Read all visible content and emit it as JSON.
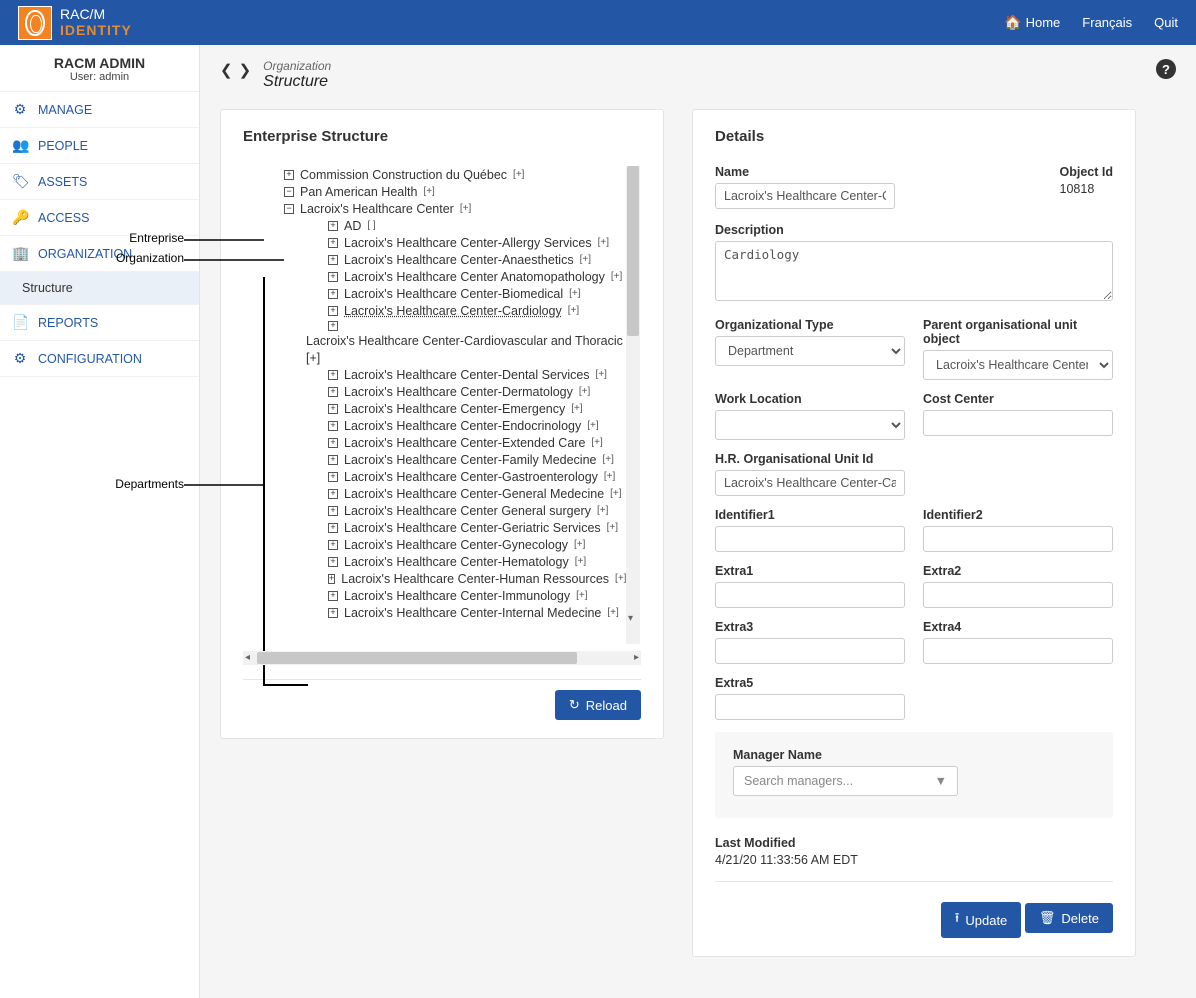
{
  "brand": {
    "line1": "RAC/M",
    "line2": "IDENTITY"
  },
  "topnav": {
    "home": "Home",
    "lang": "Français",
    "quit": "Quit"
  },
  "sidebar": {
    "title": "RACM ADMIN",
    "user_label": "User: admin",
    "items": [
      {
        "icon": "⚙",
        "label": "MANAGE"
      },
      {
        "icon": "👥",
        "label": "PEOPLE"
      },
      {
        "icon": "🏷",
        "label": "ASSETS"
      },
      {
        "icon": "🔑",
        "label": "ACCESS"
      },
      {
        "icon": "🏢",
        "label": "ORGANIZATION"
      },
      {
        "icon": "📄",
        "label": "REPORTS"
      },
      {
        "icon": "⚙",
        "label": "CONFIGURATION"
      }
    ],
    "sub_structure": "Structure"
  },
  "breadcrumb": {
    "parent": "Organization",
    "page": "Structure"
  },
  "tree": {
    "title": "Enterprise Structure",
    "reload": "Reload",
    "nodes": [
      {
        "lvl": 1,
        "exp": "+",
        "label": "Commission Construction du Québec",
        "il": "[+]"
      },
      {
        "lvl": 1,
        "exp": "−",
        "label": "Pan American Health",
        "il": "[+]"
      },
      {
        "lvl": 1,
        "exp": "−",
        "label": "Lacroix's Healthcare Center",
        "il": "[+]"
      },
      {
        "lvl": 2,
        "exp": "+",
        "label": "AD",
        "il": "[ ]"
      },
      {
        "lvl": 2,
        "exp": "+",
        "label": "Lacroix's Healthcare Center-Allergy Services",
        "il": "[+]"
      },
      {
        "lvl": 2,
        "exp": "+",
        "label": "Lacroix's Healthcare Center-Anaesthetics",
        "il": "[+]"
      },
      {
        "lvl": 2,
        "exp": "+",
        "label": "Lacroix's Healthcare Center Anatomopathology",
        "il": "[+]"
      },
      {
        "lvl": 2,
        "exp": "+",
        "label": "Lacroix's Healthcare Center-Biomedical",
        "il": "[+]"
      },
      {
        "lvl": 2,
        "exp": "+",
        "label": "Lacroix's Healthcare Center-Cardiology",
        "il": "[+]",
        "sel": true
      },
      {
        "lvl": 2,
        "exp": "+",
        "label": "",
        "il": ""
      },
      {
        "lvl": 2,
        "exp": "",
        "label": "Lacroix's Healthcare Center-Cardiovascular and Thoracic Su",
        "il": "",
        "noexp": true
      },
      {
        "lvl": 2,
        "exp": "",
        "label": "[+]",
        "il": "",
        "noexp": true,
        "plain": true
      },
      {
        "lvl": 2,
        "exp": "+",
        "label": "Lacroix's Healthcare Center-Dental Services",
        "il": "[+]"
      },
      {
        "lvl": 2,
        "exp": "+",
        "label": "Lacroix's Healthcare Center-Dermatology",
        "il": "[+]"
      },
      {
        "lvl": 2,
        "exp": "+",
        "label": "Lacroix's Healthcare Center-Emergency",
        "il": "[+]"
      },
      {
        "lvl": 2,
        "exp": "+",
        "label": "Lacroix's Healthcare Center-Endocrinology",
        "il": "[+]"
      },
      {
        "lvl": 2,
        "exp": "+",
        "label": "Lacroix's Healthcare Center-Extended Care",
        "il": "[+]"
      },
      {
        "lvl": 2,
        "exp": "+",
        "label": "Lacroix's Healthcare Center-Family Medecine",
        "il": "[+]"
      },
      {
        "lvl": 2,
        "exp": "+",
        "label": "Lacroix's Healthcare Center-Gastroenterology",
        "il": "[+]"
      },
      {
        "lvl": 2,
        "exp": "+",
        "label": "Lacroix's Healthcare Center-General Medecine",
        "il": "[+]"
      },
      {
        "lvl": 2,
        "exp": "+",
        "label": "Lacroix's Healthcare Center General surgery",
        "il": "[+]"
      },
      {
        "lvl": 2,
        "exp": "+",
        "label": "Lacroix's Healthcare Center-Geriatric Services",
        "il": "[+]"
      },
      {
        "lvl": 2,
        "exp": "+",
        "label": "Lacroix's Healthcare Center-Gynecology",
        "il": "[+]"
      },
      {
        "lvl": 2,
        "exp": "+",
        "label": "Lacroix's Healthcare Center-Hematology",
        "il": "[+]"
      },
      {
        "lvl": 2,
        "exp": "+",
        "label": "Lacroix's Healthcare Center-Human Ressources",
        "il": "[+]"
      },
      {
        "lvl": 2,
        "exp": "+",
        "label": "Lacroix's Healthcare Center-Immunology",
        "il": "[+]"
      },
      {
        "lvl": 2,
        "exp": "+",
        "label": "Lacroix's Healthcare Center-Internal Medecine",
        "il": "[+]"
      }
    ]
  },
  "details": {
    "title": "Details",
    "name_label": "Name",
    "name_value": "Lacroix's Healthcare Center-Can",
    "oid_label": "Object Id",
    "oid_value": "10818",
    "desc_label": "Description",
    "desc_value": "Cardiology",
    "orgtype_label": "Organizational Type",
    "orgtype_value": "Department",
    "parent_label": "Parent organisational unit object",
    "parent_value": "Lacroix's Healthcare Center",
    "workloc_label": "Work Location",
    "workloc_value": "",
    "cost_label": "Cost Center",
    "cost_value": "",
    "hr_label": "H.R. Organisational Unit Id",
    "hr_value": "Lacroix's Healthcare Center-Can",
    "id1_label": "Identifier1",
    "id1_value": "",
    "id2_label": "Identifier2",
    "id2_value": "",
    "e1_label": "Extra1",
    "e1_value": "",
    "e2_label": "Extra2",
    "e2_value": "",
    "e3_label": "Extra3",
    "e3_value": "",
    "e4_label": "Extra4",
    "e4_value": "",
    "e5_label": "Extra5",
    "e5_value": "",
    "mgr_label": "Manager Name",
    "mgr_placeholder": "Search managers...",
    "last_label": "Last Modified",
    "last_value": "4/21/20 11:33:56 AM EDT",
    "update": "Update",
    "delete": "Delete"
  },
  "annotations": {
    "ent": "Entreprise",
    "org": "Organization",
    "dep": "Departments"
  }
}
